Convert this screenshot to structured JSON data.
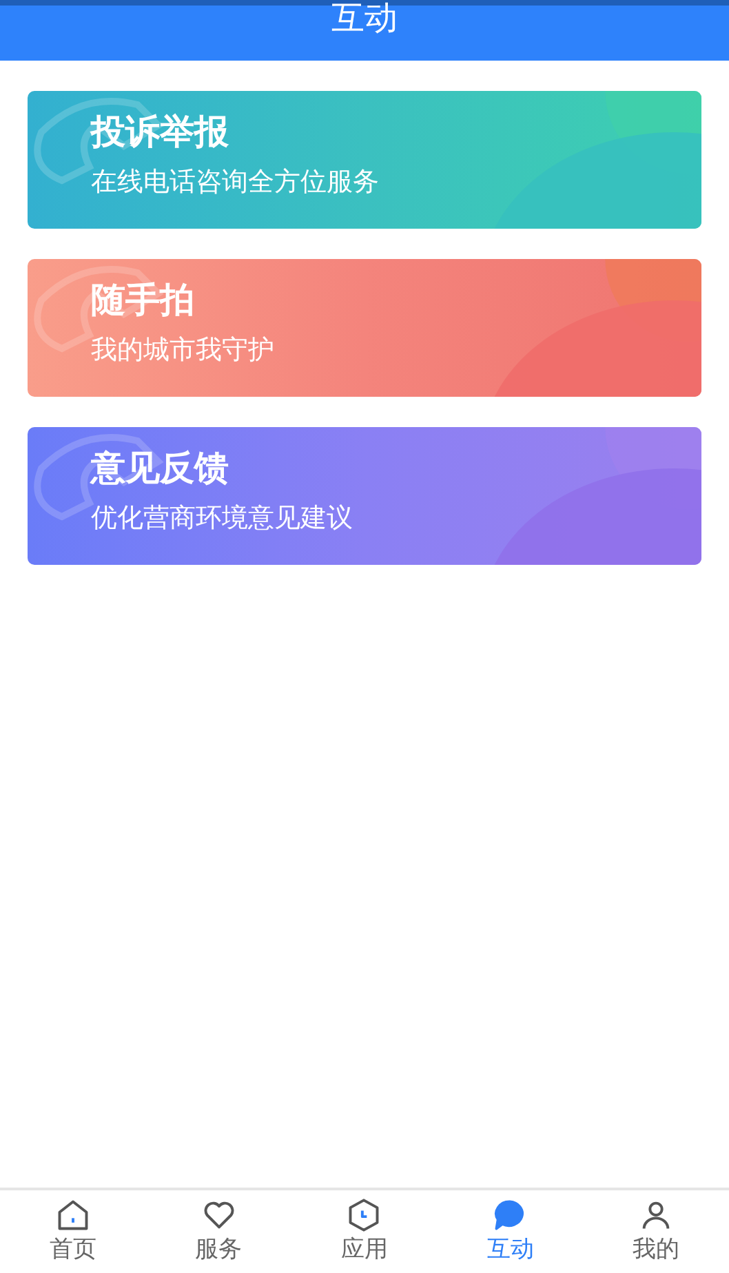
{
  "header": {
    "title": "互动"
  },
  "cards": [
    {
      "title": "投诉举报",
      "subtitle": "在线电话咨询全方位服务",
      "kind": "teal"
    },
    {
      "title": "随手拍",
      "subtitle": "我的城市我守护",
      "kind": "coral"
    },
    {
      "title": "意见反馈",
      "subtitle": "优化营商环境意见建议",
      "kind": "violet"
    }
  ],
  "nav": [
    {
      "label": "首页",
      "kind": "home",
      "selected": false
    },
    {
      "label": "服务",
      "kind": "heart",
      "selected": false
    },
    {
      "label": "应用",
      "kind": "app",
      "selected": false
    },
    {
      "label": "互动",
      "kind": "chat",
      "selected": true
    },
    {
      "label": "我的",
      "kind": "user",
      "selected": false
    }
  ]
}
